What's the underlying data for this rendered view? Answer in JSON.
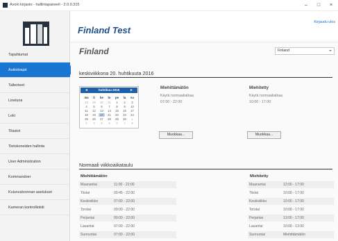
{
  "window": {
    "title": "Avoin kirjasto - hallintapaneeli - 2.0.0.315",
    "controls": [
      "–",
      "□",
      "×"
    ]
  },
  "app": {
    "name": "Finland Test",
    "logout": "Kirjaudu ulos"
  },
  "sidebar": {
    "logo_icon": "bookshelf-logo",
    "items": [
      {
        "label": "Tapahtumat"
      },
      {
        "label": "Aukioloajat"
      },
      {
        "label": "Tallenteet"
      },
      {
        "label": "Lineluna"
      },
      {
        "label": "Loki"
      },
      {
        "label": "Tilastot"
      },
      {
        "label": "Tietokoneiden hallinta"
      },
      {
        "label": "User Administration"
      },
      {
        "label": "Kommandoer"
      },
      {
        "label": "Kulunvalvonnan asetukset"
      },
      {
        "label": "Kameran kontrolliokiti"
      }
    ],
    "active_index": 1
  },
  "page": {
    "title": "Finland",
    "select_value": "Finland"
  },
  "day_section": {
    "title": "keskiviikkona 20. huhtikuuta 2016",
    "columns": [
      {
        "heading": "Miehittämätön",
        "line1": "Käytä normaaliaikaa",
        "line2": "07:00 - 22:00",
        "button": "Muokkaa..."
      },
      {
        "heading": "Miehitetty",
        "line1": "Käytä normaaliaikaa",
        "line2": "10:00 - 17:00",
        "button": "Muokkaa..."
      }
    ]
  },
  "calendar": {
    "month": "huhtikuu 2016",
    "prev": "◄",
    "next": "►",
    "weekdays": [
      "ma",
      "ti",
      "ke",
      "to",
      "pe",
      "la",
      "su"
    ],
    "weeks": [
      [
        "28",
        "29",
        "30",
        "31",
        "1",
        "2",
        "3"
      ],
      [
        "4",
        "5",
        "6",
        "7",
        "8",
        "9",
        "10"
      ],
      [
        "11",
        "12",
        "13",
        "14",
        "15",
        "16",
        "17"
      ],
      [
        "18",
        "19",
        "20",
        "21",
        "22",
        "23",
        "24"
      ],
      [
        "25",
        "26",
        "27",
        "28",
        "29",
        "30",
        "1"
      ],
      [
        "2",
        "3",
        "4",
        "5",
        "6",
        "7",
        "8"
      ]
    ],
    "selected": "20"
  },
  "schedule": {
    "title": "Normaali viikkoaikataulu",
    "unattended": {
      "heading": "Miehittämätön",
      "rows": [
        {
          "day": "Maanantai",
          "time": "11:00 - 22:00"
        },
        {
          "day": "Tiistai",
          "time": "09:45 - 22:00"
        },
        {
          "day": "Keskiviikko",
          "time": "07:00 - 22:00"
        },
        {
          "day": "Torstai",
          "time": "09:00 - 22:00"
        },
        {
          "day": "Perjantai",
          "time": "09:00 - 22:00"
        },
        {
          "day": "Lauantai",
          "time": "07:00 - 22:00"
        },
        {
          "day": "Sunnuntai",
          "time": "07:00 - 22:00"
        }
      ]
    },
    "attended": {
      "heading": "Miehitetty",
      "rows": [
        {
          "day": "Maanantai",
          "time": "12:00 - 17:00"
        },
        {
          "day": "Tiistai",
          "time": "10:00 - 17:00"
        },
        {
          "day": "Keskiviikko",
          "time": "10:00 - 17:00"
        },
        {
          "day": "Torstai",
          "time": "10:00 - 17:00"
        },
        {
          "day": "Perjantai",
          "time": "13:00 - 17:00"
        },
        {
          "day": "Lauantai",
          "time": "10:00 - 13:00"
        },
        {
          "day": "Sunnuntai",
          "time": "Miehittämätön"
        }
      ]
    }
  }
}
